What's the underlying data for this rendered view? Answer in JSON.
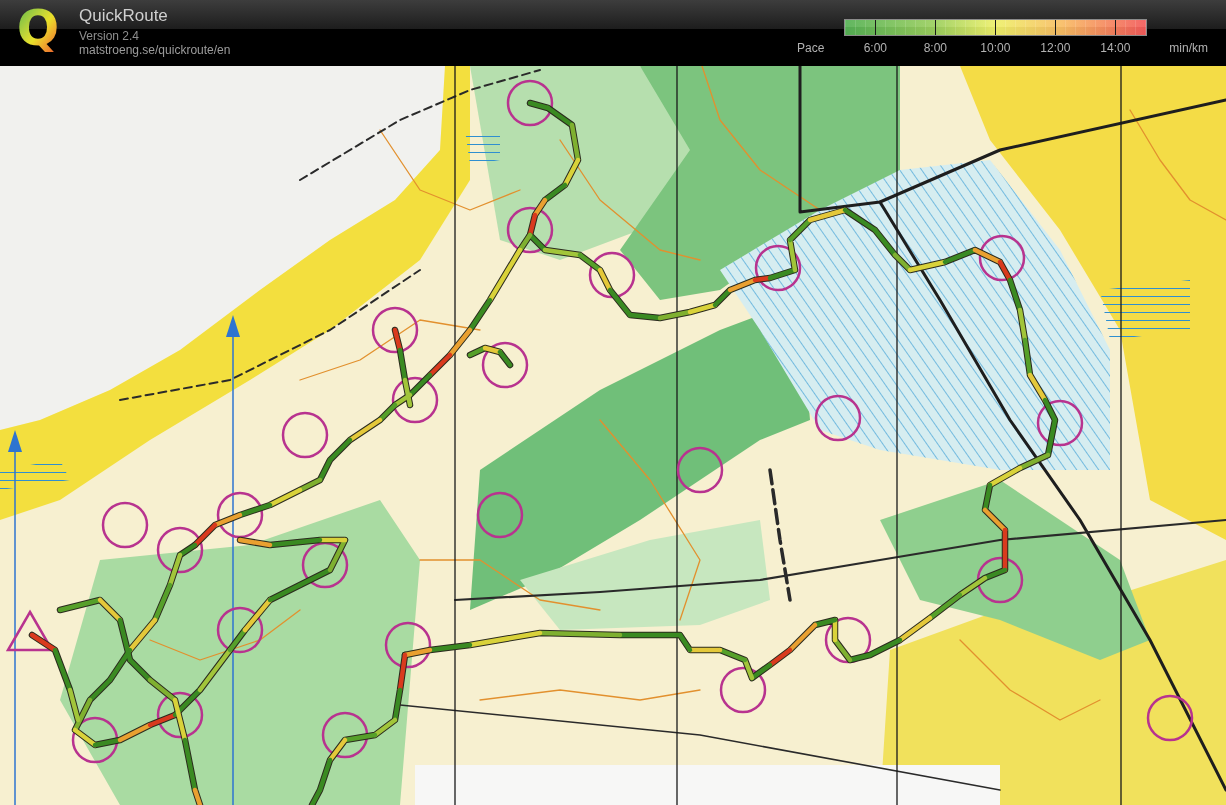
{
  "app": {
    "logo": "Q",
    "title": "QuickRoute",
    "version": "Version 2.4",
    "url": "matstroeng.se/quickroute/en"
  },
  "pace_legend": {
    "label": "Pace",
    "ticks": [
      "6:00",
      "8:00",
      "10:00",
      "12:00",
      "14:00"
    ],
    "unit": "min/km"
  }
}
